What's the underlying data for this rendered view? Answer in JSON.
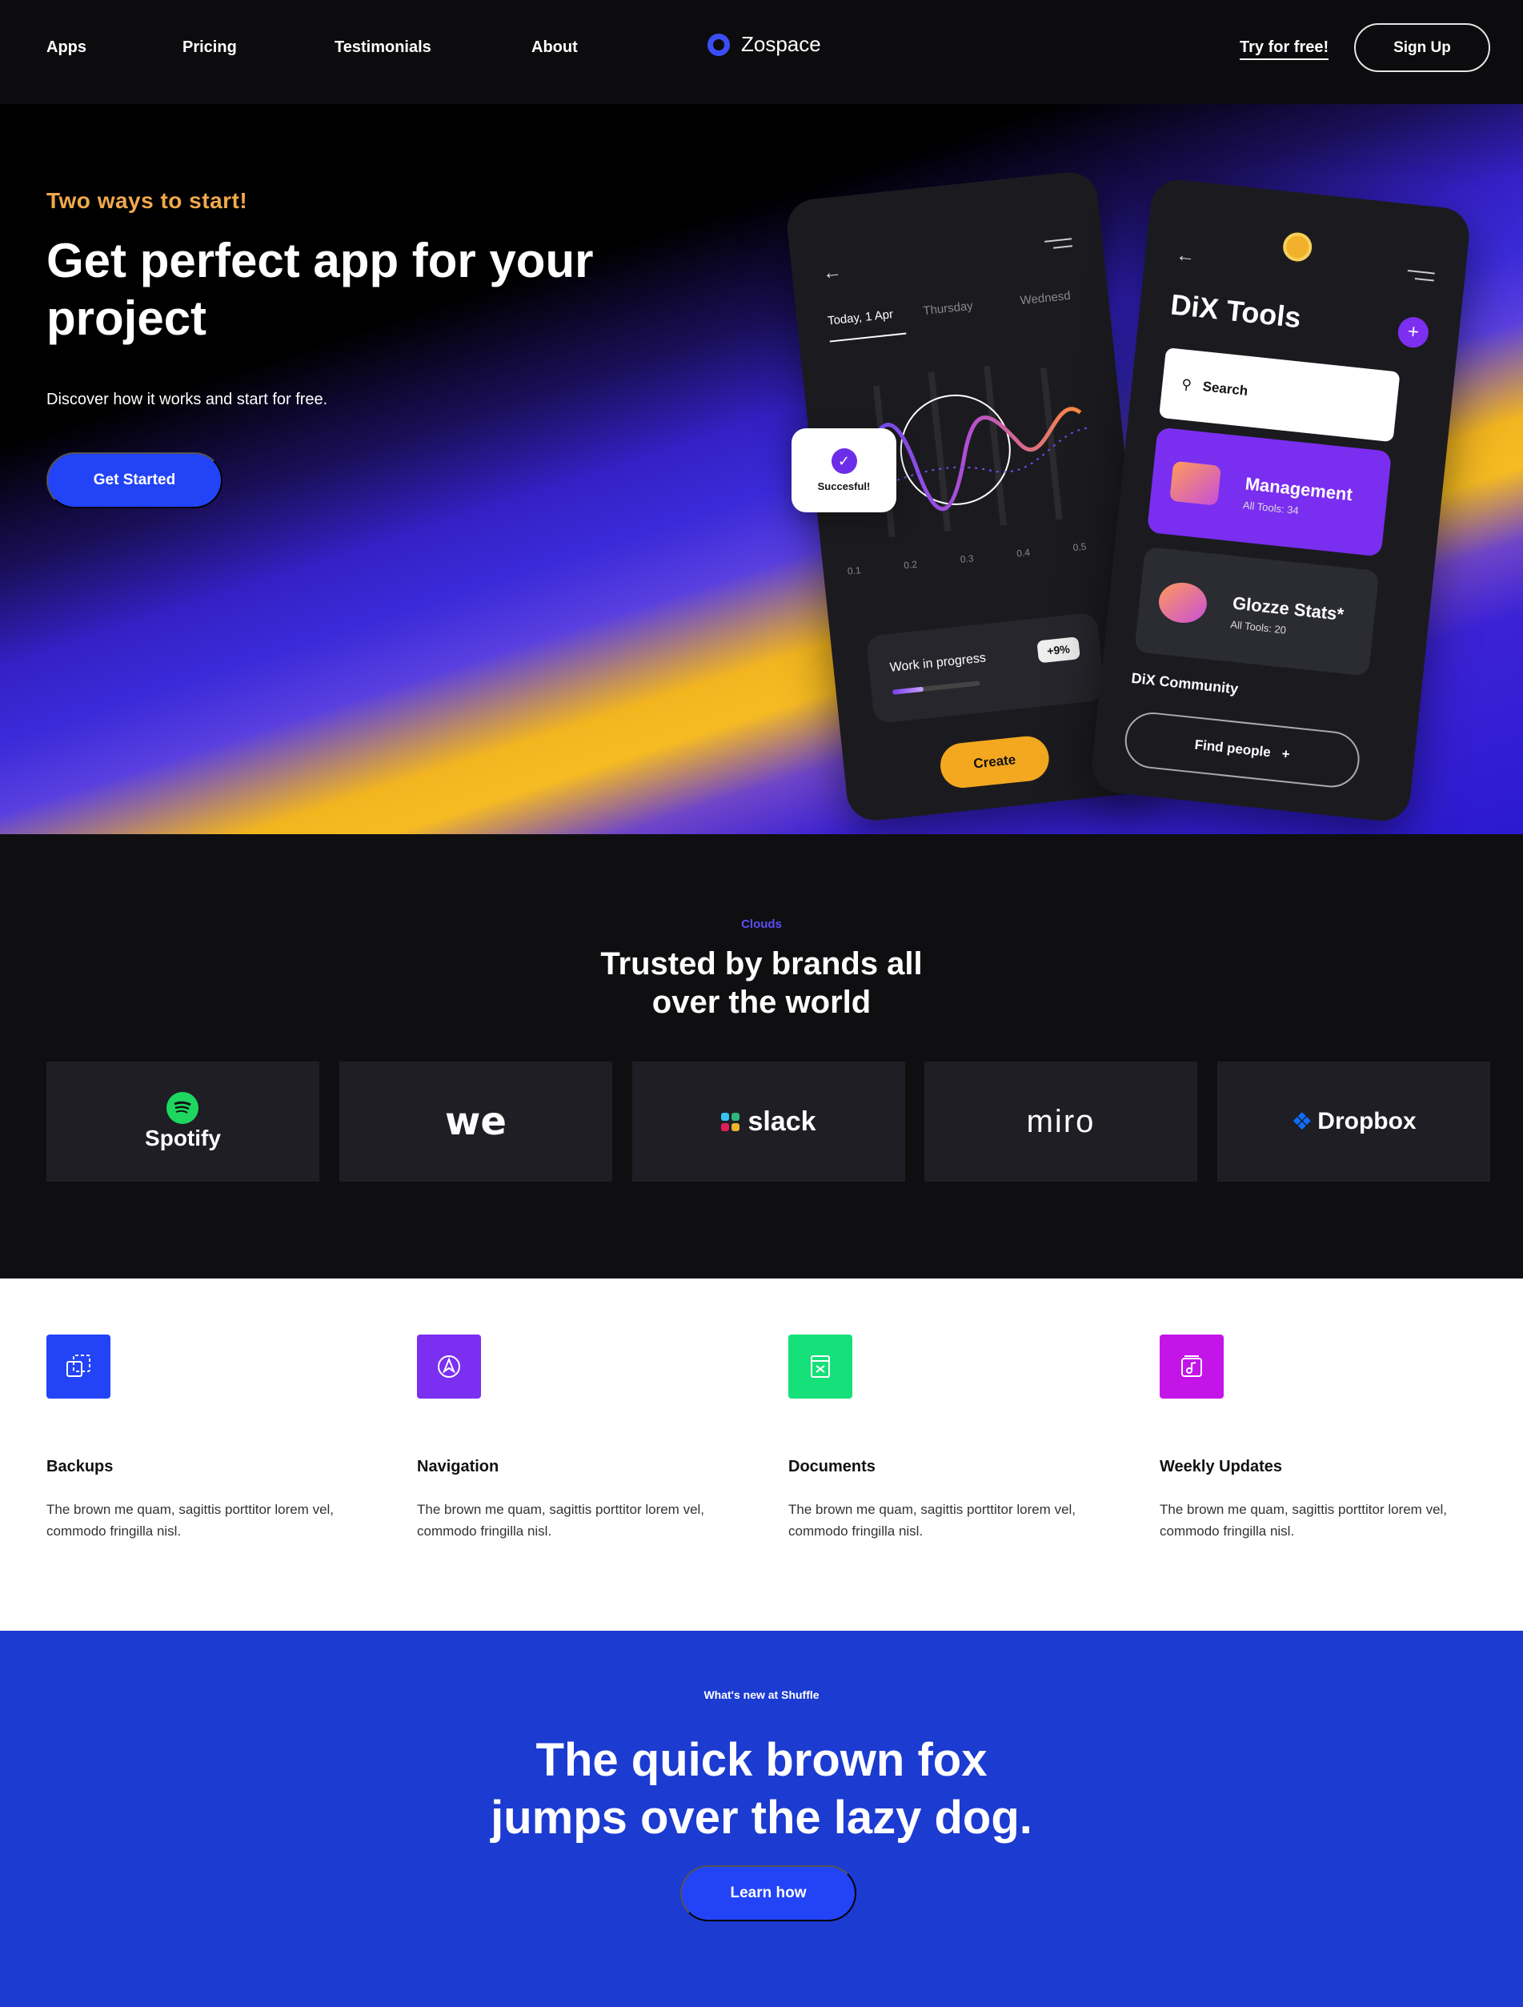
{
  "nav": {
    "links": [
      "Apps",
      "Pricing",
      "Testimonials",
      "About"
    ],
    "brand": "Zospace",
    "try_free": "Try for free!",
    "sign_up": "Sign Up"
  },
  "hero": {
    "kicker": "Two ways to start!",
    "title": "Get perfect app for your project",
    "subtitle": "Discover how it works and start for free.",
    "cta": "Get Started",
    "phone1": {
      "days": [
        "Today, 1 Apr",
        "Thursday",
        "Wednesd"
      ],
      "ticks": [
        "0.1",
        "0.2",
        "0.3",
        "0.4",
        "0.5"
      ],
      "success": "Succesful!",
      "wip_label": "Work in progress",
      "wip_badge": "+9%",
      "wip_progress": 0.35,
      "create": "Create"
    },
    "phone2": {
      "title": "DiX Tools",
      "search": "Search",
      "cards": [
        {
          "name": "Management",
          "sub": "All Tools: 34"
        },
        {
          "name": "Glozze Stats*",
          "sub": "All Tools: 20"
        }
      ],
      "community": "DiX Community",
      "find": "Find people"
    },
    "colors": {
      "accent": "#2343f7",
      "orange": "#f1a94b",
      "purple": "#7a2ef0"
    }
  },
  "brands": {
    "kicker": "Clouds",
    "title_line1": "Trusted by brands all",
    "title_line2": "over the world",
    "logos": [
      "Spotify",
      "we",
      "slack",
      "miro",
      "Dropbox"
    ]
  },
  "features": [
    {
      "title": "Backups",
      "text": "The brown me quam, sagittis porttitor lorem vel, commodo fringilla nisl.",
      "icon": "backup-icon",
      "color": "#2343f7"
    },
    {
      "title": "Navigation",
      "text": "The brown me quam, sagittis porttitor lorem vel, commodo fringilla nisl.",
      "icon": "navigation-icon",
      "color": "#7b2ff0"
    },
    {
      "title": "Documents",
      "text": "The brown me quam, sagittis porttitor lorem vel, commodo fringilla nisl.",
      "icon": "document-icon",
      "color": "#16e07a"
    },
    {
      "title": "Weekly Updates",
      "text": "The brown me quam, sagittis porttitor lorem vel, commodo fringilla nisl.",
      "icon": "music-icon",
      "color": "#c415e8"
    }
  ],
  "news": {
    "kicker": "What's new at Shuffle",
    "title_line1": "The quick brown fox",
    "title_line2": "jumps over the lazy dog.",
    "cta": "Learn how"
  }
}
